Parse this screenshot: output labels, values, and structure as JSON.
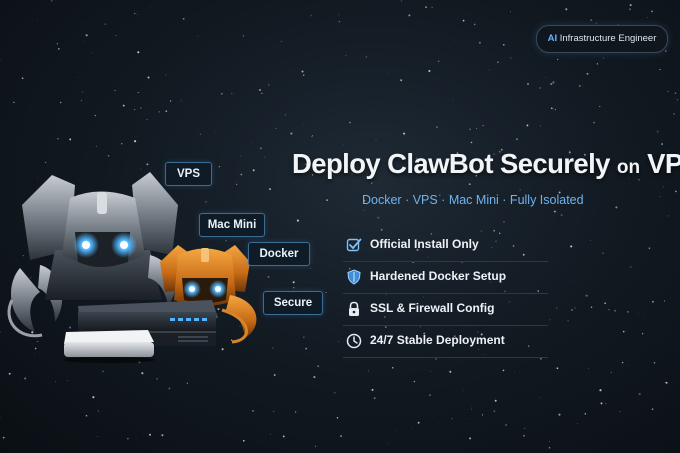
{
  "badge": {
    "prefix": "AI",
    "text": "Infrastructure Engineer"
  },
  "title": {
    "main": "Deploy ClawBot Securely",
    "small": "on",
    "end": "VPS"
  },
  "subtitle": "Docker · VPS · Mac Mini · Fully Isolated",
  "features": [
    {
      "icon": "checkbox-icon",
      "label": "Official Install Only"
    },
    {
      "icon": "shield-icon",
      "label": "Hardened Docker Setup"
    },
    {
      "icon": "lock-icon",
      "label": "SSL & Firewall Config"
    },
    {
      "icon": "clock-icon",
      "label": "24/7 Stable Deployment"
    }
  ],
  "tags": {
    "vps": "VPS",
    "mac_mini": "Mac Mini",
    "docker": "Docker",
    "secure": "Secure"
  },
  "colors": {
    "accent": "#6fb3ee",
    "background": "#121a22",
    "robot_orange": "#e8892a",
    "eye_glow": "#4fb6ff"
  }
}
